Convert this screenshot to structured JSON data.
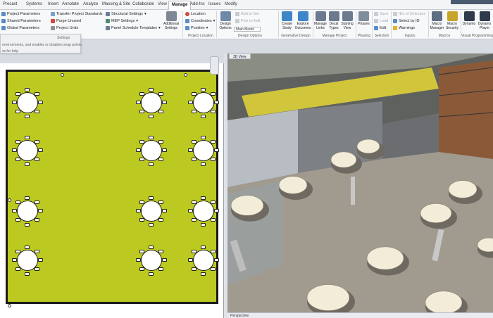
{
  "menu_tabs": [
    "Precast",
    "Systems",
    "Insert",
    "Annotate",
    "Analyze",
    "Massing & Site",
    "Collaborate",
    "View",
    "Manage",
    "Add-Ins",
    "Issues",
    "Modify"
  ],
  "active_tab": "Manage",
  "ribbon": {
    "settings_col1": [
      "Project Parameters",
      "Shared Parameters",
      "Global Parameters"
    ],
    "settings_col2": [
      "Transfer Project Standards",
      "Purge Unused",
      "Project Units"
    ],
    "settings_col3": [
      "Structural Settings",
      "MEP Settings",
      "Panel Schedule Templates"
    ],
    "additional_settings": "Additional Settings",
    "location_items": [
      "Location",
      "Coordinates",
      "Position"
    ],
    "design_options_btn": "Design Options",
    "design_opt_items": [
      "Add to Set",
      "Pick to Edit"
    ],
    "main_model": "Main Model",
    "gen_items": [
      "Create Study",
      "Explore Outcomes"
    ],
    "manage_project": [
      "Manage Links",
      "Decal Types",
      "Starting View"
    ],
    "phases": "Phases",
    "selection_items": [
      "Save",
      "Load",
      "Edit"
    ],
    "inquiry_items": [
      "IDs of Selection",
      "Select by ID",
      "Warnings"
    ],
    "macro_items": [
      "Macro Manager",
      "Macro Security"
    ],
    "visual_items": [
      "Dynamo",
      "Dynamo Player"
    ],
    "panels": [
      "Settings",
      "Project Location",
      "Design Options",
      "Generative Design",
      "Manage Project",
      "Phasing",
      "Selection",
      "Inquiry",
      "Macros",
      "Visual Programming"
    ]
  },
  "tooltip": {
    "line1": "Settings",
    "line2": "environments, and enables or disables snap points.",
    "line3": "ss for help"
  },
  "view3d_tab": "3D View",
  "status": {
    "view_mode": "Perspective"
  },
  "colors": {
    "floor_fill": "#bcc920",
    "ribbon_bg": "#f7f8fa",
    "active_tab_bg": "#ffffff"
  }
}
